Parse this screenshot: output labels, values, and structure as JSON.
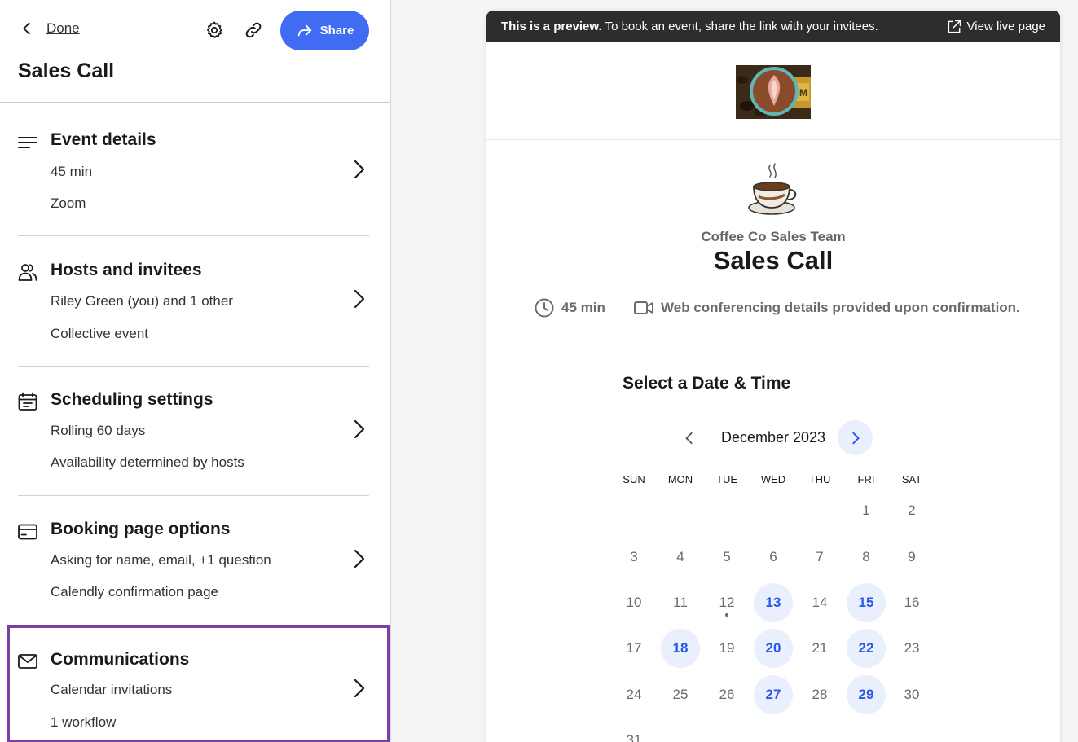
{
  "header": {
    "done_label": "Done",
    "share_label": "Share",
    "event_title": "Sales Call"
  },
  "sections": [
    {
      "title": "Event details",
      "line1": "45 min",
      "line2": "Zoom",
      "icon": "lines-icon"
    },
    {
      "title": "Hosts and invitees",
      "line1": "Riley Green (you) and 1 other",
      "line2": "Collective event",
      "icon": "people-icon"
    },
    {
      "title": "Scheduling settings",
      "line1": "Rolling 60 days",
      "line2": "Availability determined by hosts",
      "icon": "calendar-icon"
    },
    {
      "title": "Booking page options",
      "line1": "Asking for name, email, +1 question",
      "line2": "Calendly confirmation page",
      "icon": "card-icon"
    },
    {
      "title": "Communications",
      "line1": "Calendar invitations",
      "line2": "1 workflow",
      "icon": "mail-icon"
    }
  ],
  "preview": {
    "banner_bold": "This is a preview.",
    "banner_text": " To book an event, share the link with your invitees.",
    "view_live": "View live page",
    "team": "Coffee Co Sales Team",
    "title": "Sales Call",
    "duration": "45 min",
    "location": "Web conferencing details provided upon confirmation.",
    "select_title": "Select a Date & Time",
    "month": "December 2023",
    "weekdays": [
      "SUN",
      "MON",
      "TUE",
      "WED",
      "THU",
      "FRI",
      "SAT"
    ],
    "days": [
      "1",
      "2",
      "3",
      "4",
      "5",
      "6",
      "7",
      "8",
      "9",
      "10",
      "11",
      "12",
      "13",
      "14",
      "15",
      "16",
      "17",
      "18",
      "19",
      "20",
      "21",
      "22",
      "23",
      "24",
      "25",
      "26",
      "27",
      "28",
      "29",
      "30",
      "31"
    ],
    "available": [
      "13",
      "15",
      "18",
      "20",
      "22",
      "27",
      "29"
    ],
    "today": "12"
  },
  "colors": {
    "accent": "#3f6cf3",
    "highlight": "#7b3fa5",
    "available_bg": "#e9effd",
    "available_text": "#2b58e8"
  }
}
